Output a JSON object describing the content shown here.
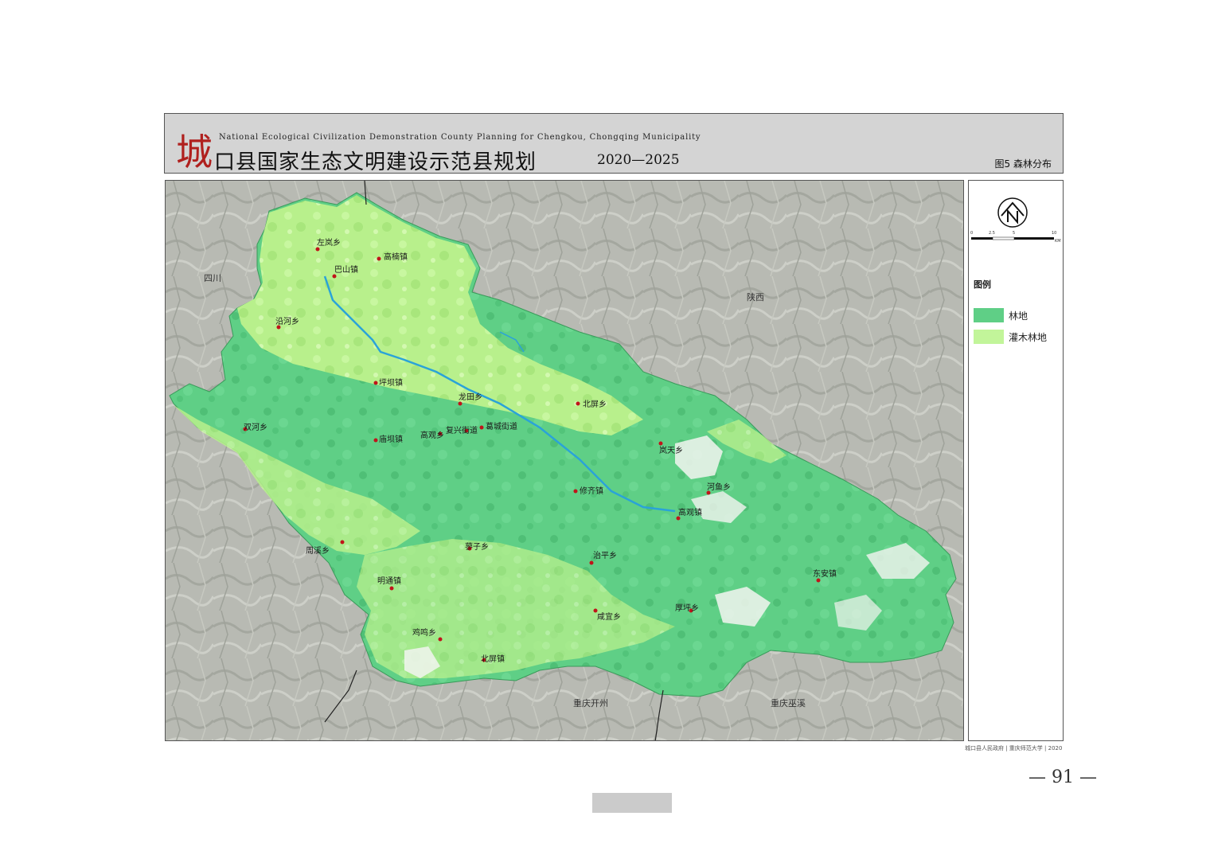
{
  "header": {
    "logo_char": "城",
    "subtitle_en": "National Ecological Civilization Demonstration County Planning for Chengkou, Chongqing Municipality",
    "title_cn": "口县国家生态文明建设示范县规划",
    "years": "2020—2025",
    "figure_label": "图5  森林分布"
  },
  "scale_bar": {
    "ticks": [
      "0",
      "2.5",
      "5",
      "10"
    ],
    "unit": "KM"
  },
  "legend": {
    "title": "图例",
    "items": [
      {
        "label": "林地",
        "color": "#5fcf86"
      },
      {
        "label": "灌木林地",
        "color": "#c2f59a"
      }
    ]
  },
  "regions": {
    "sichuan": "四川",
    "shaanxi": "陕西",
    "kaizhou": "重庆开州",
    "wuxi": "重庆巫溪"
  },
  "towns": [
    {
      "name": "左岚乡"
    },
    {
      "name": "高楠镇"
    },
    {
      "name": "巴山镇"
    },
    {
      "name": "沿河乡"
    },
    {
      "name": "坪坝镇"
    },
    {
      "name": "龙田乡"
    },
    {
      "name": "北屏乡"
    },
    {
      "name": "双河乡"
    },
    {
      "name": "庙坝镇"
    },
    {
      "name": "高观乡"
    },
    {
      "name": "复兴街道"
    },
    {
      "name": "葛城街道"
    },
    {
      "name": "岚天乡"
    },
    {
      "name": "修齐镇"
    },
    {
      "name": "河鱼乡"
    },
    {
      "name": "高观镇"
    },
    {
      "name": "周溪乡"
    },
    {
      "name": "蓼子乡"
    },
    {
      "name": "治平乡"
    },
    {
      "name": "明通镇"
    },
    {
      "name": "东安镇"
    },
    {
      "name": "咸宜乡"
    },
    {
      "name": "厚坪乡"
    },
    {
      "name": "鸡鸣乡"
    },
    {
      "name": "北屏镇"
    }
  ],
  "credit": "城口县人民政府 | 重庆师范大学 | 2020",
  "page_number": "— 91 —"
}
